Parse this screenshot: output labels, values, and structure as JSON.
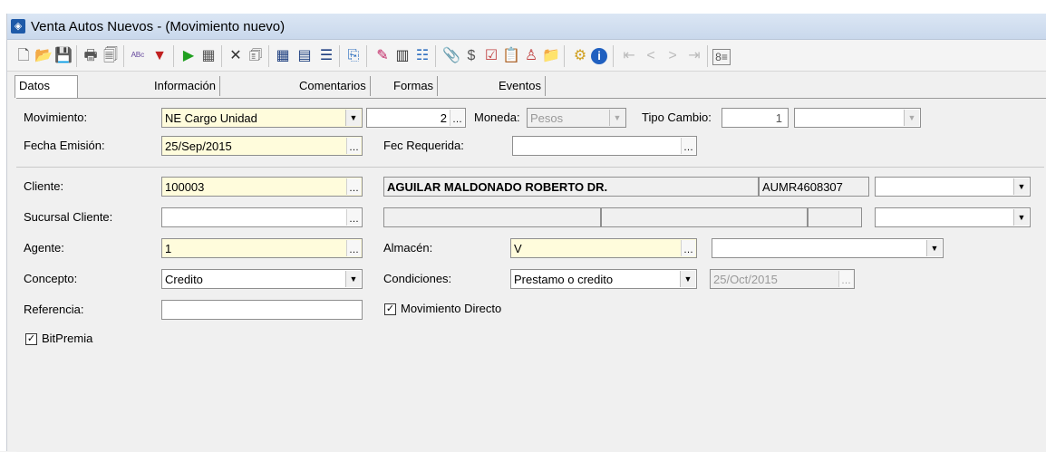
{
  "window": {
    "title": "Venta Autos Nuevos - (Movimiento nuevo)"
  },
  "tabs": [
    "Datos Generales",
    "Información adicional",
    "Comentarios",
    "Formas Anexas",
    "Eventos"
  ],
  "toolbar_icons": [
    "new-icon",
    "open-icon",
    "save-icon",
    "print-icon",
    "print-preview-icon",
    "spellcheck-icon",
    "filter-icon",
    "run-icon",
    "calculator-icon",
    "delete-icon",
    "cancel-doc-icon",
    "grid-icon",
    "form-icon",
    "list-icon",
    "copy-icon",
    "edit-icon",
    "barcode-icon",
    "bullets-icon",
    "attachment-icon",
    "currency-icon",
    "check-icon",
    "report-icon",
    "person-icon",
    "folder-icon",
    "settings-icon",
    "info-icon",
    "first-icon",
    "prev-icon",
    "next-icon",
    "last-icon",
    "more-icon"
  ],
  "fields": {
    "movimiento": {
      "label": "Movimiento:",
      "value": "NE Cargo Unidad",
      "number": "2"
    },
    "moneda": {
      "label": "Moneda:",
      "value": "Pesos"
    },
    "tipo_cambio": {
      "label": "Tipo Cambio:",
      "value": "1"
    },
    "fecha_emision": {
      "label": "Fecha Emisión:",
      "value": "25/Sep/2015"
    },
    "fec_requerida": {
      "label": "Fec Requerida:",
      "value": ""
    },
    "cliente": {
      "label": "Cliente:",
      "value": "100003",
      "name": "AGUILAR MALDONADO ROBERTO DR.",
      "rfc": "AUMR4608307"
    },
    "sucursal_cliente": {
      "label": "Sucursal Cliente:",
      "value": ""
    },
    "agente": {
      "label": "Agente:",
      "value": "1"
    },
    "almacen": {
      "label": "Almacén:",
      "value": "V"
    },
    "concepto": {
      "label": "Concepto:",
      "value": "Credito"
    },
    "condiciones": {
      "label": "Condiciones:",
      "value": "Prestamo o credito",
      "date": "25/Oct/2015"
    },
    "referencia": {
      "label": "Referencia:",
      "value": ""
    },
    "movimiento_directo": {
      "label": "Movimiento Directo",
      "checked": true
    },
    "bitpremia": {
      "label": "BitPremia",
      "checked": true
    }
  }
}
